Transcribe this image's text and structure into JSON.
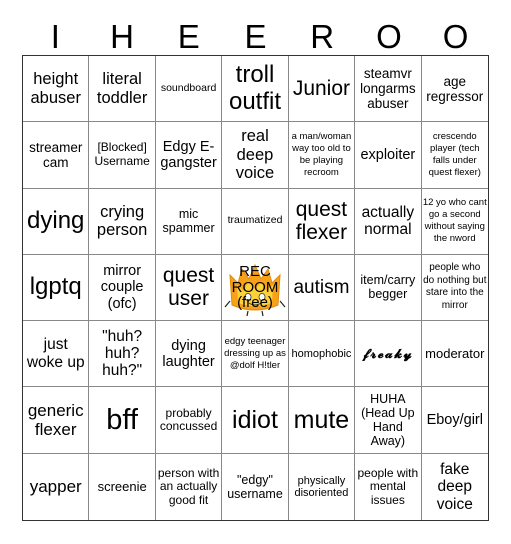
{
  "header": {
    "letters": [
      "I",
      "H",
      "E",
      "E",
      "R",
      "O",
      "O"
    ]
  },
  "board": {
    "rows": [
      [
        "height abuser",
        "literal toddler",
        "soundboard",
        "troll outfit",
        "Junior",
        "steamvr longarms abuser",
        "age regressor"
      ],
      [
        "streamer cam",
        "[Blocked] Username",
        "Edgy E-gangster",
        "real deep voice",
        "a man/woman way too old to be playing recroom",
        "exploiter",
        "crescendo player (tech falls under quest flexer)"
      ],
      [
        "dying",
        "crying person",
        "mic spammer",
        "traumatized",
        "quest flexer",
        "actually normal",
        "12 yo who cant go a second without saying the nword"
      ],
      [
        "lgptq",
        "mirror couple (ofc)",
        "quest user",
        "REC ROOM (free)",
        "autism",
        "item/carry begger",
        "people who do nothing but stare into the mirror"
      ],
      [
        "just woke up",
        "\"huh? huh? huh?\"",
        "dying laughter",
        "edgy teenager dressing up as @dolf H!tler",
        "homophobic",
        "𝓯𝓻𝓮𝓪𝓴𝔂",
        "moderator"
      ],
      [
        "generic flexer",
        "bff",
        "probably concussed",
        "idiot",
        "mute",
        "HUHA (Head Up Hand Away)",
        "Eboy/girl"
      ],
      [
        "yapper",
        "screenie",
        "person with an actually good fit",
        "\"edgy\" username",
        "physically disoriented",
        "people with mental issues",
        "fake deep voice"
      ]
    ],
    "free_space": {
      "label": "REC ROOM (free)",
      "line1": "REC",
      "line2": "ROOM",
      "line3": "(free)",
      "icon": "flame-character-icon",
      "flame_color": "#f7a11a",
      "flame_inner_color": "#fcd23a"
    }
  }
}
